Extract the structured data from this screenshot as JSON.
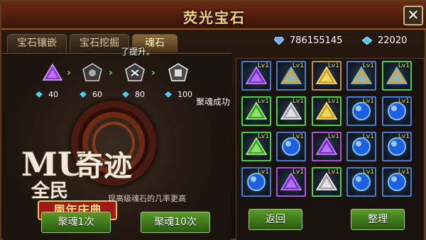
{
  "window": {
    "title": "荧光宝石"
  },
  "tabs": [
    {
      "label": "宝石镶嵌",
      "active": false
    },
    {
      "label": "宝石挖掘",
      "active": false
    },
    {
      "label": "魂石",
      "active": true
    }
  ],
  "currency": {
    "diamond": "786155145",
    "crystal": "22020"
  },
  "flow": {
    "costs": [
      "40",
      "60",
      "80",
      "100"
    ]
  },
  "messages": {
    "float_upgrade": "了提升。",
    "float_success": "聚魂成功",
    "hint": "现高级魂石的几率更高"
  },
  "logo": {
    "main": "MU奇迹",
    "sub": "全民",
    "banner": "周年庆典"
  },
  "buttons": {
    "soul_once": "聚魂1次",
    "soul_ten": "聚魂10次",
    "back": "返回",
    "sort": "整理"
  },
  "inventory": {
    "level_label": "Lv1",
    "items": [
      {
        "type": "tri-purple",
        "frame": "b"
      },
      {
        "type": "tri-rainbow",
        "frame": "b"
      },
      {
        "type": "tri-yellow",
        "frame": "o"
      },
      {
        "type": "tri-rainbow",
        "frame": "b"
      },
      {
        "type": "tri-rainbow",
        "frame": "g"
      },
      {
        "type": "tri-green",
        "frame": "g"
      },
      {
        "type": "tri-white",
        "frame": "g"
      },
      {
        "type": "tri-yellow",
        "frame": "g"
      },
      {
        "type": "orb-blue",
        "frame": "b"
      },
      {
        "type": "orb-blue",
        "frame": "b"
      },
      {
        "type": "tri-green",
        "frame": "g"
      },
      {
        "type": "orb-blue",
        "frame": "b"
      },
      {
        "type": "tri-purple",
        "frame": "p"
      },
      {
        "type": "orb-blue",
        "frame": "b"
      },
      {
        "type": "orb-blue",
        "frame": "b"
      },
      {
        "type": "orb-blue",
        "frame": "b"
      },
      {
        "type": "tri-purple",
        "frame": "p"
      },
      {
        "type": "tri-white",
        "frame": "g"
      },
      {
        "type": "orb-blue",
        "frame": "b"
      },
      {
        "type": "orb-blue",
        "frame": "b"
      }
    ]
  },
  "colors": {
    "accent_gold": "#f6d27a",
    "button_green": "#5a9a2a"
  }
}
